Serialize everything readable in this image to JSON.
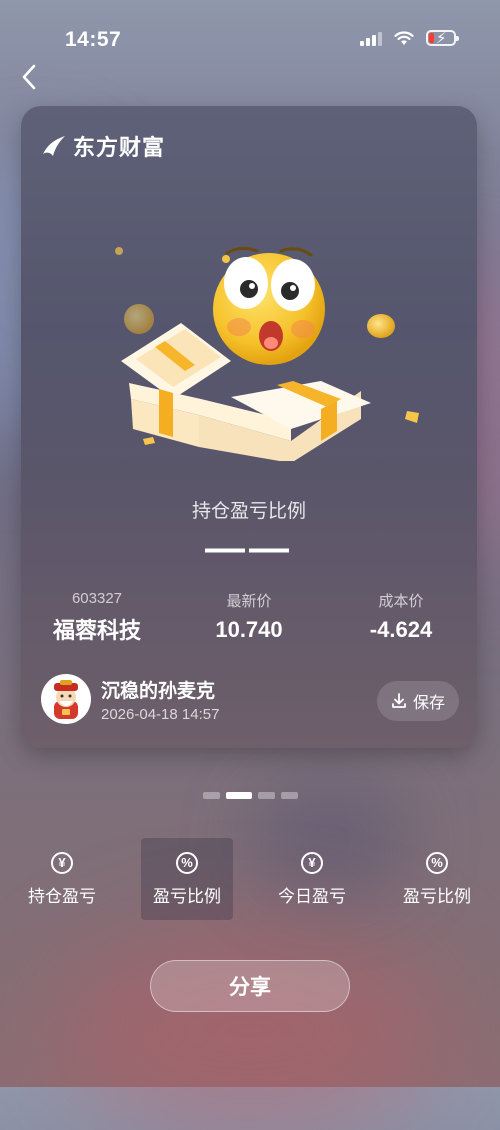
{
  "status_bar": {
    "time": "14:57"
  },
  "card": {
    "brand": "东方财富",
    "ratio_label": "持仓盈亏比例",
    "ratio_value": "——",
    "stats": [
      {
        "label": "603327",
        "value": "福蓉科技"
      },
      {
        "label": "最新价",
        "value": "10.740"
      },
      {
        "label": "成本价",
        "value": "-4.624"
      }
    ],
    "user": {
      "name": "沉稳的孙麦克",
      "datetime": "2026-04-18 14:57"
    },
    "save_label": "保存"
  },
  "pager": {
    "total": 4,
    "active_index": 1
  },
  "tabs": [
    {
      "icon": "yen-icon",
      "glyph": "¥",
      "label": "持仓盈亏"
    },
    {
      "icon": "percent-icon",
      "glyph": "%",
      "label": "盈亏比例"
    },
    {
      "icon": "yen-icon",
      "glyph": "¥",
      "label": "今日盈亏"
    },
    {
      "icon": "percent-icon",
      "glyph": "%",
      "label": "盈亏比例"
    }
  ],
  "share_label": "分享"
}
